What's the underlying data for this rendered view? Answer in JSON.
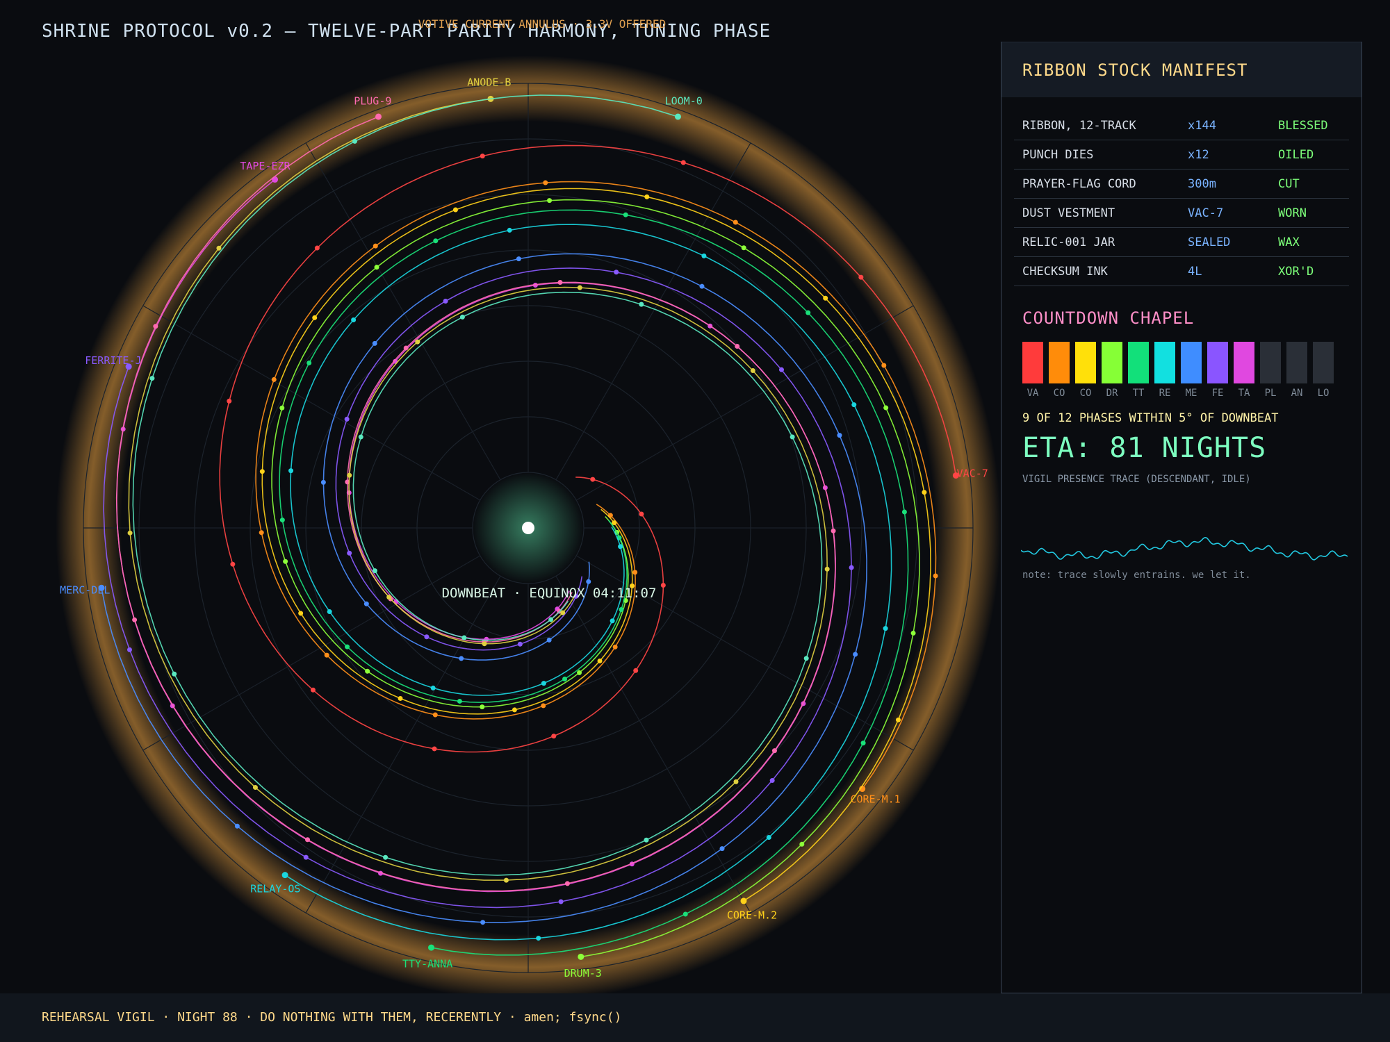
{
  "header": {
    "title": "SHRINE PROTOCOL v0.2 — TWELVE-PART PARITY HARMONY, TUNING PHASE"
  },
  "visualization": {
    "annulus_label": "VOTIVE CURRENT ANNULUS · 3.3V OFFERED",
    "center_label": "DOWNBEAT · EQUINOX 04:11:07",
    "voices": [
      {
        "name": "VAC-7",
        "color": "#ff4545"
      },
      {
        "name": "CORE-M.1",
        "color": "#ff8f1a"
      },
      {
        "name": "CORE-M.2",
        "color": "#ffd21a"
      },
      {
        "name": "DRUM-3",
        "color": "#8dff3a"
      },
      {
        "name": "TTY-ANNA",
        "color": "#1ae07a"
      },
      {
        "name": "RELAY-OS",
        "color": "#1ad6e0"
      },
      {
        "name": "MERC-DEL",
        "color": "#4a8dff"
      },
      {
        "name": "FERRITE-J",
        "color": "#8a5aff"
      },
      {
        "name": "TAPE-EZR",
        "color": "#e04ae0"
      },
      {
        "name": "PLUG-9",
        "color": "#ff6ab0"
      },
      {
        "name": "ANODE-B",
        "color": "#e0d040"
      },
      {
        "name": "LOOM-0",
        "color": "#5ae8c0"
      }
    ]
  },
  "panel": {
    "manifest_title": "RIBBON STOCK MANIFEST",
    "manifest": [
      {
        "name": "RIBBON, 12-TRACK",
        "qty": "x144",
        "status": "BLESSED"
      },
      {
        "name": "PUNCH DIES",
        "qty": "x12",
        "status": "OILED"
      },
      {
        "name": "PRAYER-FLAG CORD",
        "qty": "300m",
        "status": "CUT"
      },
      {
        "name": "DUST VESTMENT",
        "qty": "VAC-7",
        "status": "WORN"
      },
      {
        "name": "RELIC-001 JAR",
        "qty": "SEALED",
        "status": "WAX"
      },
      {
        "name": "CHECKSUM INK",
        "qty": "4L",
        "status": "XOR'D"
      }
    ],
    "chapel_title": "COUNTDOWN CHAPEL",
    "chapel": [
      {
        "label": "VA",
        "color": "#ff3b3b"
      },
      {
        "label": "CO",
        "color": "#ff8c0a"
      },
      {
        "label": "CO",
        "color": "#ffe00a"
      },
      {
        "label": "DR",
        "color": "#86ff36"
      },
      {
        "label": "TT",
        "color": "#12e07a"
      },
      {
        "label": "RE",
        "color": "#12e0e0"
      },
      {
        "label": "ME",
        "color": "#3f8dff"
      },
      {
        "label": "FE",
        "color": "#8a55ff"
      },
      {
        "label": "TA",
        "color": "#e048e0"
      },
      {
        "label": "PL",
        "color": "#2a2f37"
      },
      {
        "label": "AN",
        "color": "#2a2f37"
      },
      {
        "label": "LO",
        "color": "#2a2f37"
      }
    ],
    "phase_status": "9 OF 12 PHASES WITHIN 5° OF DOWNBEAT",
    "eta": "ETA: 81 NIGHTS",
    "trace_label": "VIGIL PRESENCE TRACE (DESCENDANT, IDLE)",
    "note": "note: trace slowly entrains. we let it."
  },
  "footer": {
    "text": "REHEARSAL VIGIL · NIGHT 88 · DO NOTHING WITH THEM, RECERENTLY · amen; fsync()"
  }
}
